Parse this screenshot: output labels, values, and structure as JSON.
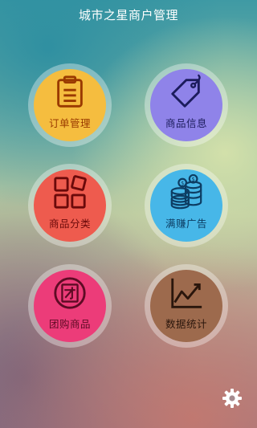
{
  "header": {
    "title": "城市之星商户管理"
  },
  "menu": [
    {
      "label": "订单管理",
      "icon": "clipboard-icon",
      "bg": "#f5bd3f",
      "fg": "#9a3a00"
    },
    {
      "label": "商品信息",
      "icon": "price-tag-icon",
      "bg": "#8f83e9",
      "fg": "#1c1c5c"
    },
    {
      "label": "商品分类",
      "icon": "category-grid-icon",
      "bg": "#ee5b4e",
      "fg": "#6b0a0a"
    },
    {
      "label": "满赚广告",
      "icon": "coin-stack-icon",
      "bg": "#47b7e8",
      "fg": "#0d3d63"
    },
    {
      "label": "团购商品",
      "icon": "group-buy-icon",
      "bg": "#ec3c79",
      "fg": "#5e0b24"
    },
    {
      "label": "数据统计",
      "icon": "line-chart-icon",
      "bg": "#9d6a4d",
      "fg": "#2a160c"
    }
  ],
  "settings": {
    "icon": "gear-icon"
  }
}
